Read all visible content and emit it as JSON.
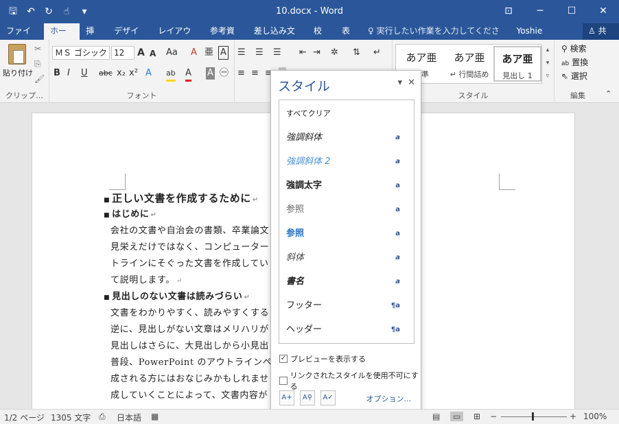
{
  "titlebar": {
    "title": "10.docx - Word",
    "qat": {
      "save": "🖫",
      "undo": "↶",
      "redo": "↻",
      "touch": "☝",
      "customize": "▾"
    },
    "controls": {
      "ribbon_options": "⊡",
      "minimize": "─",
      "maximize": "☐",
      "close": "✕"
    }
  },
  "tabs": {
    "items": [
      {
        "label": "ファイル"
      },
      {
        "label": "ホーム"
      },
      {
        "label": "挿入"
      },
      {
        "label": "デザイン"
      },
      {
        "label": "レイアウト"
      },
      {
        "label": "参考資料"
      },
      {
        "label": "差し込み文書"
      },
      {
        "label": "校閲"
      },
      {
        "label": "表示"
      }
    ],
    "tellme": "♀ 実行したい作業を入力してください...",
    "user": "Yoshie Kohama",
    "share": "共有"
  },
  "ribbon": {
    "clipboard": {
      "paste": "貼り付け",
      "label": "クリップ…",
      "cut": "✂",
      "copy": "⎘",
      "format_painter": "🖌"
    },
    "font": {
      "label": "フォント",
      "font_name": "ＭＳ ゴシック (",
      "font_size": "12",
      "grow": "A",
      "shrink": "A",
      "case": "Aa",
      "clear": "A",
      "phonetic": "亜",
      "border": "A",
      "bold": "B",
      "italic": "I",
      "underline": "U",
      "strike": "abc",
      "sub": "x₂",
      "sup": "x²",
      "effects": "A",
      "highlight": "ab",
      "color": "A",
      "shade": "A",
      "enclose": "㊀"
    },
    "paragraph": {
      "label": "段落"
    },
    "styles": {
      "label": "スタイル",
      "items": [
        {
          "preview": "あア亜",
          "name": "標準"
        },
        {
          "preview": "あア亜",
          "name": "↵ 行間詰め"
        },
        {
          "preview": "あア亜",
          "name": "見出し 1"
        }
      ]
    },
    "editing": {
      "label": "編集",
      "find": "検索",
      "replace": "置換",
      "select": "選択"
    }
  },
  "document": {
    "lines": [
      {
        "type": "h1",
        "text": "正しい文書を作成するために"
      },
      {
        "type": "h2",
        "text": "はじめに"
      },
      {
        "type": "body",
        "text": "会社の文書や自治会の書類、卒業論文                                    書を作成するには、"
      },
      {
        "type": "body",
        "text": "見栄えだけではなく、コンピューター                                    、すなわち、アウ"
      },
      {
        "type": "body",
        "text": "トラインにそぐった文書を作成してい                                    い文書作成につい"
      },
      {
        "type": "body",
        "text": "て説明します。"
      },
      {
        "type": "h2",
        "text": "見出しのない文書は読みづらい"
      },
      {
        "type": "body",
        "text": "文書をわかりやすく、読みやすくする                                    が欠かせません。"
      },
      {
        "type": "body",
        "text": "逆に、見出しがない文章はメリハリが"
      },
      {
        "type": "body",
        "text": "見出しはさらに、大見出しから小見出                                    します。"
      },
      {
        "type": "body",
        "text": "普段、PowerPoint のアウトラインペ                                    ーション資料を作"
      },
      {
        "type": "body",
        "text": "成される方にはおなじみかもしれませ                                    ラインレベルで構"
      },
      {
        "type": "body",
        "text": "成していくことによって、文書内容が"
      }
    ]
  },
  "styles_pane": {
    "title": "スタイル",
    "dropdown": "▾",
    "close": "✕",
    "items": [
      {
        "name": "すべてクリア",
        "mark": ""
      },
      {
        "name": "強調斜体",
        "mark": "a"
      },
      {
        "name": "強調斜体 2",
        "mark": "a"
      },
      {
        "name": "強調太字",
        "mark": "a"
      },
      {
        "name": "参照",
        "mark": "a"
      },
      {
        "name": "参照",
        "mark": "a"
      },
      {
        "name": "斜体",
        "mark": "a"
      },
      {
        "name": "書名",
        "mark": "a"
      },
      {
        "name": "フッター",
        "mark": "¶a"
      },
      {
        "name": "ヘッダー",
        "mark": "¶a"
      }
    ],
    "show_preview": "プレビューを表示する",
    "show_preview_checked": "✓",
    "disable_linked": "リンクされたスタイルを使用不可にする",
    "options": "オプション..."
  },
  "statusbar": {
    "page": "1/2 ページ",
    "words": "1305 文字",
    "proof": "⎙",
    "language": "日本語",
    "macro": "▦",
    "zoom_minus": "−",
    "zoom_plus": "+",
    "zoom": "100%"
  }
}
